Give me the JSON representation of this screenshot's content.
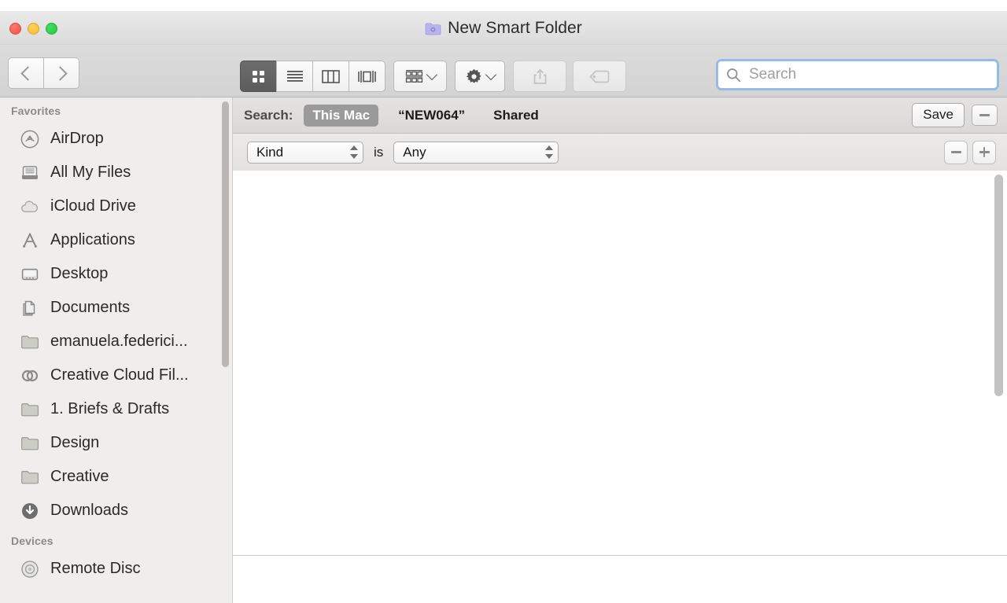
{
  "window": {
    "title": "New Smart Folder",
    "title_icon": "smart-folder-icon",
    "traffic_lights": {
      "close_color": "#f4524a",
      "minimize_color": "#f6bc32",
      "zoom_color": "#26ca41"
    }
  },
  "toolbar": {
    "back_icon": "chevron-left-icon",
    "forward_icon": "chevron-right-icon",
    "view_modes": [
      {
        "name": "icon-view",
        "icon": "grid-icon",
        "selected": true
      },
      {
        "name": "list-view",
        "icon": "list-icon",
        "selected": false
      },
      {
        "name": "column-view",
        "icon": "columns-icon",
        "selected": false
      },
      {
        "name": "coverflow-view",
        "icon": "coverflow-icon",
        "selected": false
      }
    ],
    "arrange": {
      "label": "",
      "icon": "arrange-grid-icon",
      "disabled": false
    },
    "action": {
      "label": "",
      "icon": "gear-icon",
      "disabled": false
    },
    "share": {
      "label": "",
      "icon": "share-icon",
      "disabled": true
    },
    "tags": {
      "label": "",
      "icon": "tag-icon",
      "disabled": true
    }
  },
  "search": {
    "placeholder": "Search",
    "value": "",
    "icon": "search-icon",
    "focused": true,
    "focus_ring_color": "#96bbe8"
  },
  "search_scope": {
    "label": "Search:",
    "options": [
      {
        "label": "This Mac",
        "selected": true
      },
      {
        "label": "“NEW064”",
        "selected": false
      },
      {
        "label": "Shared",
        "selected": false
      }
    ],
    "selected_pill_color": "#9a9a9a",
    "save_label": "Save",
    "remove_icon": "minus-icon"
  },
  "criteria": {
    "attribute": {
      "value": "Kind",
      "icon": "stepper-icon"
    },
    "operator": "is",
    "value": {
      "value": "Any",
      "icon": "stepper-icon"
    },
    "remove_icon": "minus-icon",
    "add_icon": "plus-icon"
  },
  "sidebar": {
    "sections": [
      {
        "header": "Favorites",
        "items": [
          {
            "label": "AirDrop",
            "icon": "airdrop-icon"
          },
          {
            "label": "All My Files",
            "icon": "all-my-files-icon"
          },
          {
            "label": "iCloud Drive",
            "icon": "icloud-icon"
          },
          {
            "label": "Applications",
            "icon": "applications-icon"
          },
          {
            "label": "Desktop",
            "icon": "desktop-icon"
          },
          {
            "label": "Documents",
            "icon": "documents-icon"
          },
          {
            "label": "emanuela.federici...",
            "icon": "folder-icon"
          },
          {
            "label": "Creative Cloud Fil...",
            "icon": "creative-cloud-icon"
          },
          {
            "label": "1. Briefs & Drafts",
            "icon": "folder-icon"
          },
          {
            "label": "Design",
            "icon": "folder-icon"
          },
          {
            "label": "Creative",
            "icon": "folder-icon"
          },
          {
            "label": "Downloads",
            "icon": "downloads-icon"
          }
        ]
      },
      {
        "header": "Devices",
        "items": [
          {
            "label": "Remote Disc",
            "icon": "disc-icon"
          }
        ]
      }
    ]
  },
  "results": {
    "items": [],
    "empty": true
  }
}
